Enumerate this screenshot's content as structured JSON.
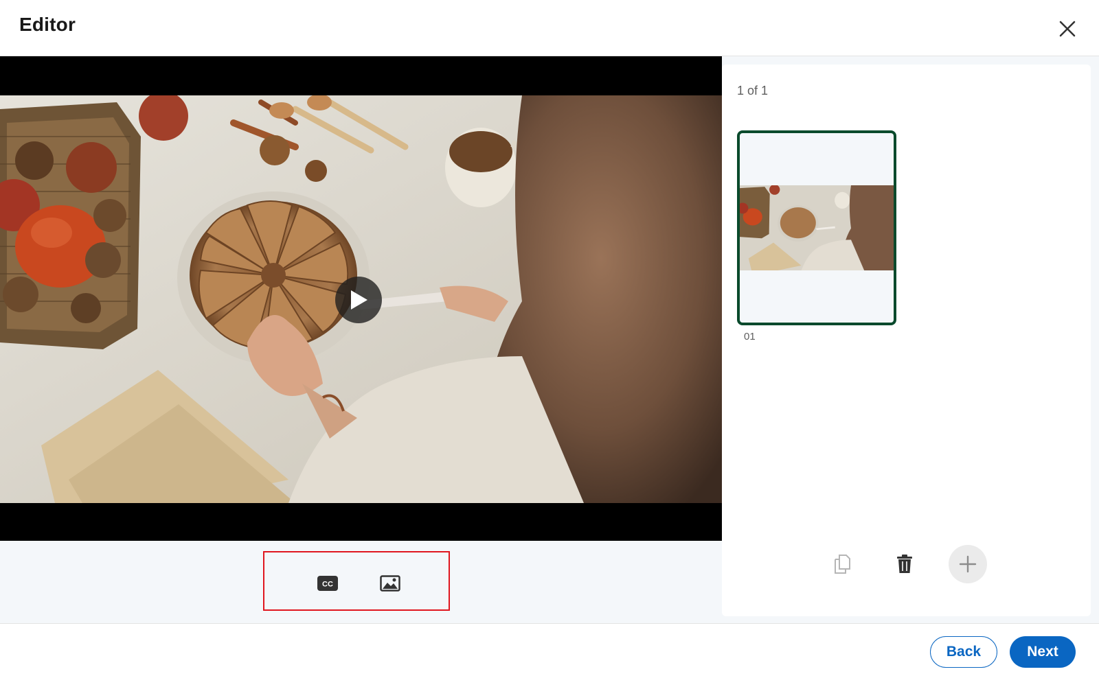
{
  "header": {
    "title": "Editor",
    "close_icon": "close-icon"
  },
  "player": {
    "play_icon": "play-icon"
  },
  "media_toolbar": {
    "captions_icon": "closed-captions-icon",
    "thumbnail_icon": "image-thumbnail-icon",
    "highlight_color": "#e0161e"
  },
  "side_panel": {
    "counter": "1 of 1",
    "slides": [
      {
        "index": "01",
        "selected": true
      }
    ],
    "selected_border_color": "#0a4a2c",
    "actions": {
      "duplicate_icon": "duplicate-icon",
      "delete_icon": "trash-icon",
      "add_icon": "plus-icon"
    }
  },
  "footer": {
    "back_label": "Back",
    "next_label": "Next",
    "accent_color": "#0a66c2"
  }
}
